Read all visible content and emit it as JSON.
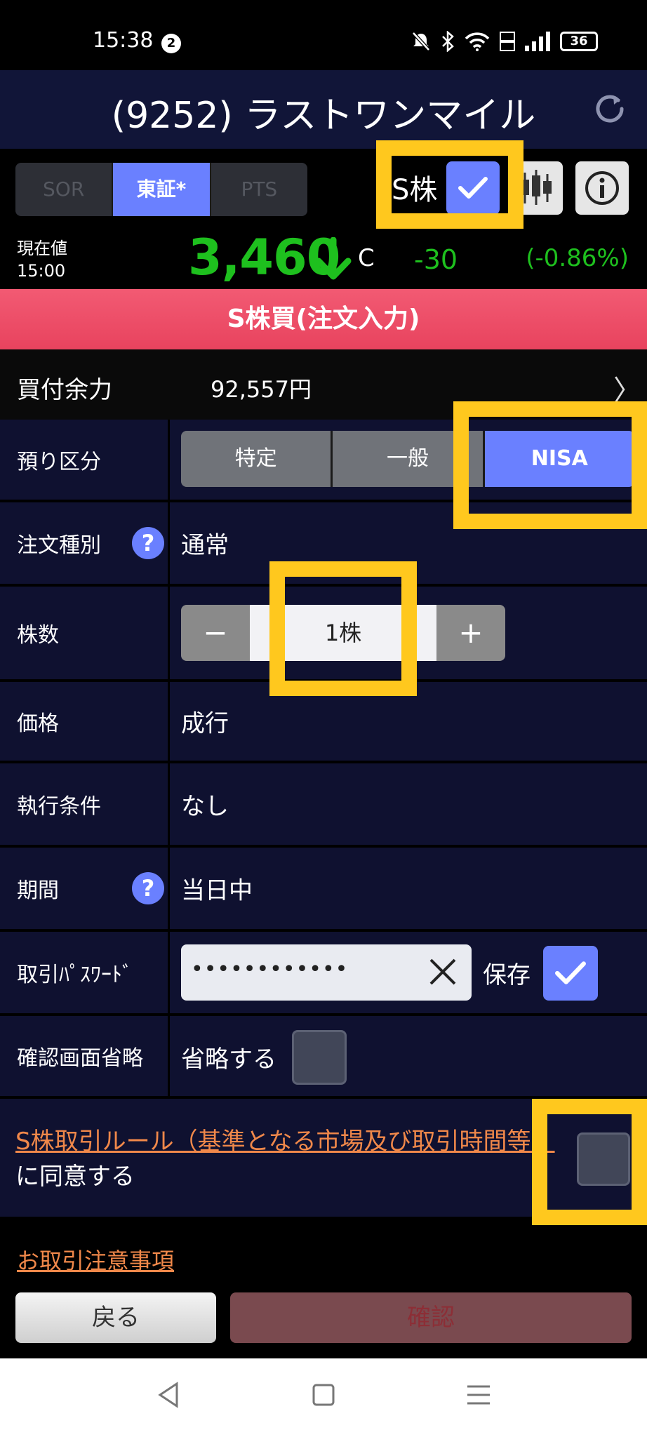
{
  "status_bar": {
    "time": "15:38",
    "notification_count": "2",
    "battery": "36"
  },
  "header": {
    "title": "(9252) ラストワンマイル"
  },
  "market_tabs": [
    {
      "label": "SOR",
      "active": false
    },
    {
      "label": "東証*",
      "active": true
    },
    {
      "label": "PTS",
      "active": false
    }
  ],
  "s_kabu": {
    "label": "S株",
    "checked": true
  },
  "quote": {
    "label": "現在値",
    "time": "15:00",
    "price": "3,460",
    "marker": "C",
    "change": "-30",
    "change_pct": "(-0.86%)"
  },
  "order_title": "S株買(注文入力)",
  "buying_power": {
    "label": "買付余力",
    "value": "92,557円",
    "arrow": "〉"
  },
  "form": {
    "account": {
      "label": "預り区分",
      "options": [
        "特定",
        "一般",
        "NISA"
      ],
      "selected": "NISA"
    },
    "order_type": {
      "label": "注文種別",
      "help": "?",
      "value": "通常"
    },
    "shares": {
      "label": "株数",
      "minus": "−",
      "value": "1株",
      "plus": "+"
    },
    "price": {
      "label": "価格",
      "value": "成行"
    },
    "condition": {
      "label": "執行条件",
      "value": "なし"
    },
    "period": {
      "label": "期間",
      "help": "?",
      "value": "当日中"
    },
    "password": {
      "label": "取引ﾊﾟｽﾜｰﾄﾞ",
      "value": "••••••••••••",
      "save_label": "保存",
      "save_checked": true
    },
    "skip_confirm": {
      "label": "確認画面省略",
      "option_label": "省略する",
      "checked": false
    }
  },
  "agreement": {
    "link_text": "S株取引ルール（基準となる市場及び取引時間等）",
    "suffix": "に同意する",
    "checked": false
  },
  "notice_link": "お取引注意事項",
  "buttons": {
    "back": "戻る",
    "confirm": "確認"
  },
  "colors": {
    "accent": "#6a80ff",
    "highlight": "#ffc81e",
    "price_green": "#1ec01e",
    "order_red": "#e8435e",
    "link_orange": "#f0884a"
  }
}
